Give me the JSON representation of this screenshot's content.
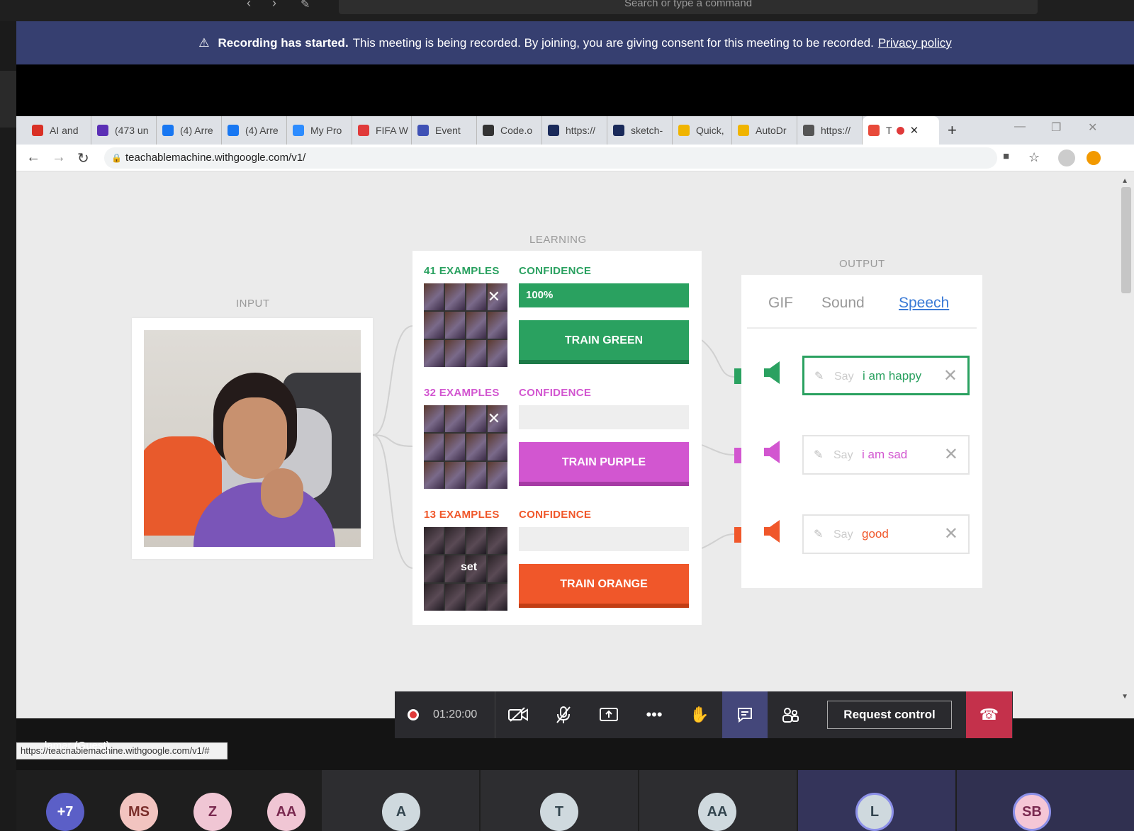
{
  "teams": {
    "search_placeholder": "Search or type a command",
    "banner": {
      "bold": "Recording has started.",
      "text": "This meeting is being recorded. By joining, you are giving consent for this meeting to be recorded.",
      "link": "Privacy policy"
    },
    "guest_name": "lamar (Guest)",
    "timer": "01:20:00",
    "request_control": "Request control",
    "participants": [
      "+7",
      "MS",
      "Z",
      "AA",
      "A",
      "T",
      "AA",
      "L",
      "SB"
    ]
  },
  "browser": {
    "tabs": [
      {
        "label": "AI and",
        "icon": "gmail-icon",
        "color": "#d93025"
      },
      {
        "label": "(473 un",
        "icon": "mail-icon",
        "color": "#5b2fb5"
      },
      {
        "label": "(4) Arre",
        "icon": "facebook-icon",
        "color": "#1877f2"
      },
      {
        "label": "(4) Arre",
        "icon": "facebook-icon",
        "color": "#1877f2"
      },
      {
        "label": "My Pro",
        "icon": "zoom-icon",
        "color": "#2d8cff"
      },
      {
        "label": "FIFA W",
        "icon": "s-icon",
        "color": "#e03a3a"
      },
      {
        "label": "Event",
        "icon": "calendar-icon",
        "color": "#3f51b5"
      },
      {
        "label": "Code.o",
        "icon": "code-icon",
        "color": "#333333"
      },
      {
        "label": "https://",
        "icon": "sketch-icon",
        "color": "#1a2a5a"
      },
      {
        "label": "sketch-",
        "icon": "sketch-icon",
        "color": "#1a2a5a"
      },
      {
        "label": "Quick,",
        "icon": "quickdraw-icon",
        "color": "#f0b400"
      },
      {
        "label": "AutoDr",
        "icon": "autodraw-icon",
        "color": "#f0b400"
      },
      {
        "label": "https://",
        "icon": "globe-icon",
        "color": "#555555"
      },
      {
        "label": "T",
        "icon": "teachable-icon",
        "color": "#e84a3a"
      }
    ],
    "url": "teachablemachine.withgoogle.com/v1/",
    "status_url": "https://teachablemachine.withgoogle.com/v1/#"
  },
  "machine": {
    "input_label": "INPUT",
    "learning_label": "LEARNING",
    "output_label": "OUTPUT",
    "classes": [
      {
        "examples": "41 EXAMPLES",
        "confidence_label": "CONFIDENCE",
        "confidence_text": "100%",
        "confidence_value": 1.0,
        "train_label": "TRAIN GREEN",
        "color": "#2aa160",
        "dark": "#1d7a48"
      },
      {
        "examples": "32 EXAMPLES",
        "confidence_label": "CONFIDENCE",
        "confidence_text": "",
        "confidence_value": 0.0,
        "train_label": "TRAIN PURPLE",
        "color": "#d256d0",
        "dark": "#a63aa5"
      },
      {
        "examples": "13 EXAMPLES",
        "confidence_label": "CONFIDENCE",
        "confidence_text": "",
        "confidence_value": 0.0,
        "train_label": "TRAIN ORANGE",
        "color": "#f0572a",
        "dark": "#c23e15",
        "reset_label": "set"
      }
    ],
    "output_tabs": [
      "GIF",
      "Sound",
      "Speech"
    ],
    "active_output_tab": "Speech",
    "say_prefix": "Say",
    "speech": [
      "i am happy",
      "i am sad",
      "good"
    ]
  }
}
